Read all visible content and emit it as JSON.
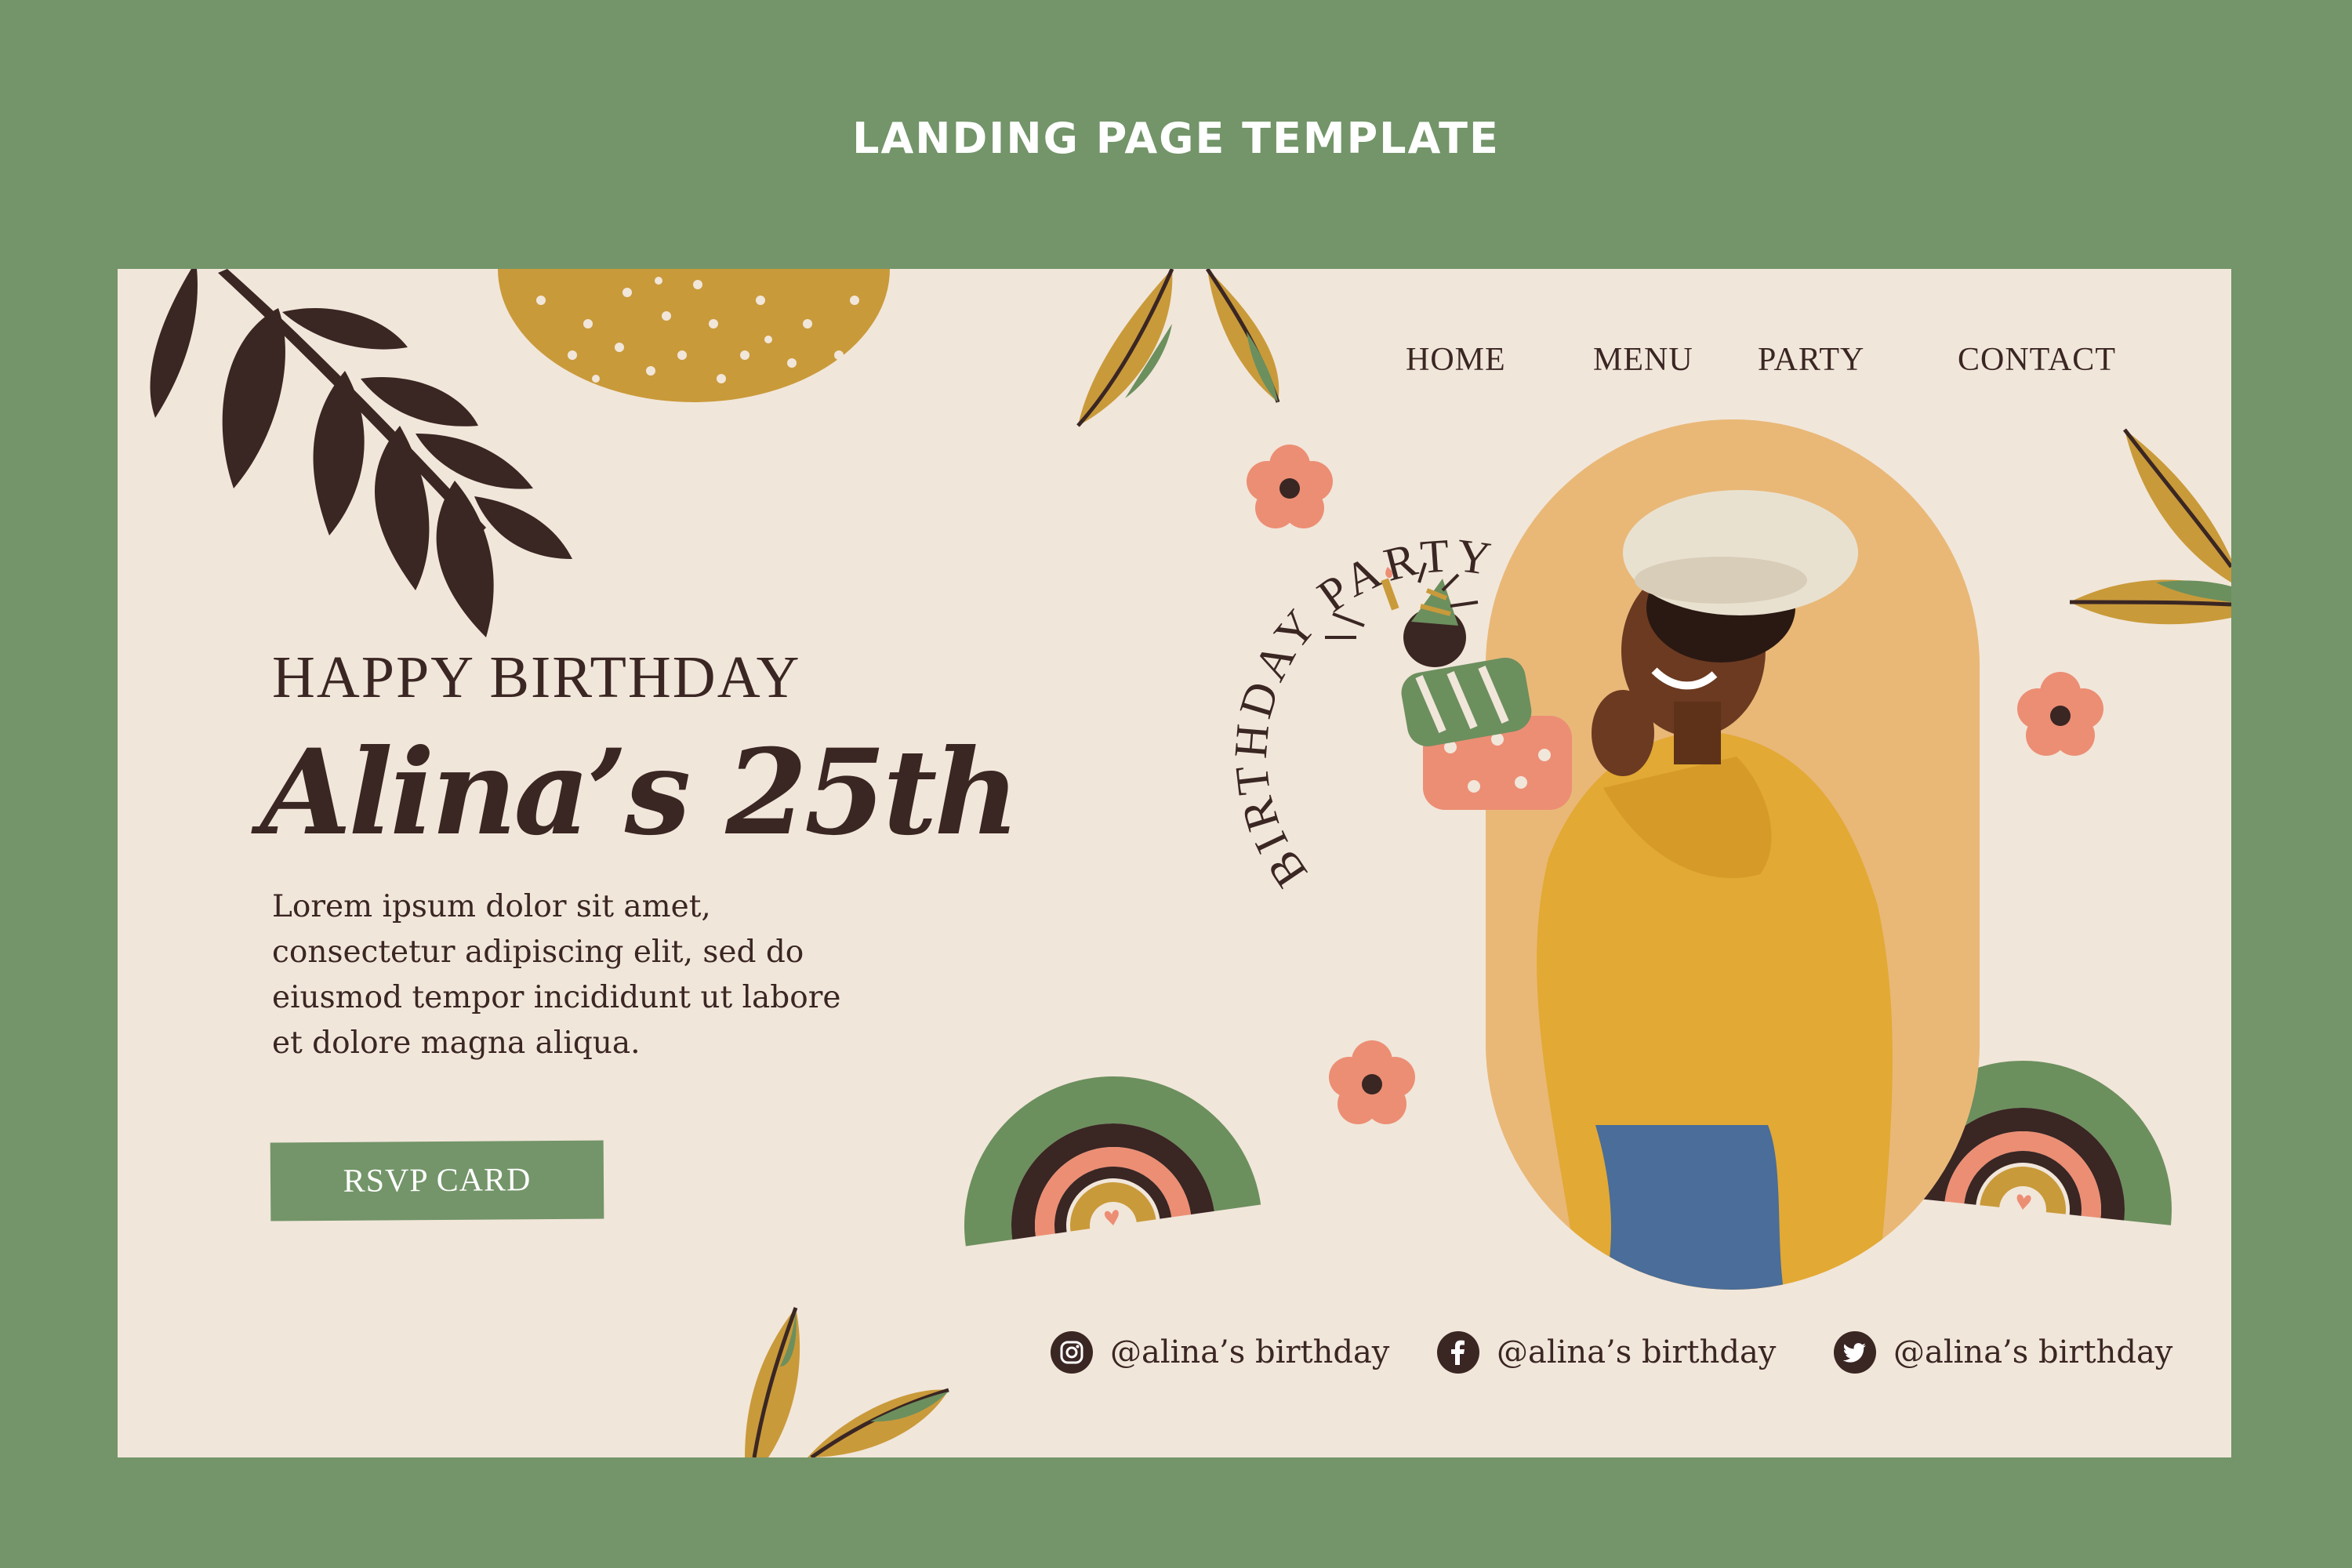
{
  "page": {
    "heading": "LANDING PAGE TEMPLATE"
  },
  "nav": {
    "items": [
      "HOME",
      "MENU",
      "PARTY",
      "CONTACT"
    ]
  },
  "hero": {
    "subtitle": "HAPPY BIRTHDAY",
    "name": "Alina’s 25th",
    "body": "Lorem ipsum dolor sit amet, consectetur adipiscing elit, sed do eiusmod tempor incididunt ut labore et dolore magna aliqua.",
    "cta_label": "RSVP CARD",
    "badge_text": "BIRTHDAY PARTY"
  },
  "social": {
    "instagram": "@alina’s birthday",
    "facebook": "@alina’s birthday",
    "twitter": "@alina’s birthday"
  },
  "colors": {
    "frame_green": "#739569",
    "card_cream": "#f1e6da",
    "text_dark": "#3a2623",
    "mustard": "#c99a3a",
    "coral": "#ec8e74",
    "leaf_green": "#6c8f5e",
    "photo_backdrop": "#e9b877"
  },
  "icons": [
    "instagram-icon",
    "facebook-icon",
    "twitter-icon"
  ]
}
